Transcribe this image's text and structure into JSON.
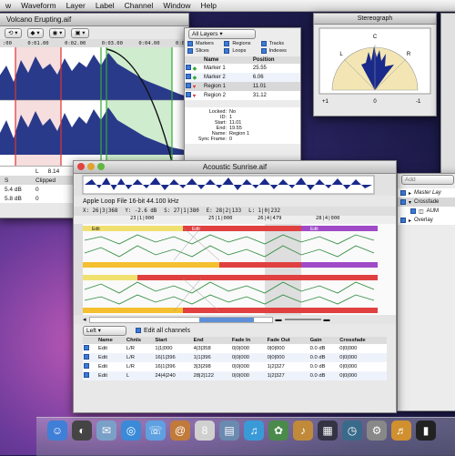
{
  "menubar": {
    "items": [
      "w",
      "Waveform",
      "Layer",
      "Label",
      "Channel",
      "Window",
      "Help"
    ]
  },
  "volcano_window": {
    "title": "Volcano Erupting.aif",
    "times": [
      ":00",
      "0:01.00",
      "0:02.00",
      "0:03.00",
      "0:04.00",
      "0:0"
    ],
    "readout_left": "L",
    "readout_value": "8.14",
    "rows": [
      {
        "a": "S",
        "b": "Clipped"
      },
      {
        "a": "5.4 dB",
        "b": "0"
      },
      {
        "a": "5.8 dB",
        "b": "0"
      }
    ]
  },
  "markers_panel": {
    "layers_select": "All Layers",
    "filters": [
      {
        "label": "Markers",
        "on": true
      },
      {
        "label": "Regions",
        "on": true
      },
      {
        "label": "Tracks",
        "on": true
      },
      {
        "label": "Slices",
        "on": true
      },
      {
        "label": "Loops",
        "on": true
      },
      {
        "label": "Indexes",
        "on": true
      }
    ],
    "columns": [
      "Name",
      "Position"
    ],
    "rows": [
      {
        "name": "Marker 1",
        "pos": "25.55",
        "kind": "marker"
      },
      {
        "name": "Marker 2",
        "pos": "6.06",
        "kind": "marker"
      },
      {
        "name": "Region 1",
        "pos": "11.01",
        "kind": "region"
      },
      {
        "name": "Region 2",
        "pos": "31.12",
        "kind": "region"
      }
    ],
    "details": [
      {
        "k": "Locked:",
        "v": "No"
      },
      {
        "k": "ID:",
        "v": "1"
      },
      {
        "k": "Start:",
        "v": "11.01"
      },
      {
        "k": "End:",
        "v": "19.55"
      },
      {
        "k": "Name:",
        "v": "Region 1"
      },
      {
        "k": "Sync Frame:",
        "v": "0"
      }
    ]
  },
  "stereograph": {
    "title": "Stereograph",
    "top_labels": [
      "L",
      "C",
      "R"
    ],
    "scale_left": "+1",
    "scale_mid": "0",
    "scale_right": "-1"
  },
  "right_panel": {
    "add_label": "Add",
    "items": [
      "Master Lay",
      "Crossfade",
      "AUM",
      "Overlay"
    ]
  },
  "acoustic_window": {
    "title": "Acoustic Sunrise.aif",
    "file_info": "Apple Loop File   16-bit  44.100 kHz",
    "coords": [
      "X: 26|3|368",
      "Y: -2.6 dB",
      "S: 27|1|380",
      "E: 28|2|133",
      "L: 1|0|232"
    ],
    "ruler": [
      "23|1|000",
      "25|1|000",
      "26|4|479",
      "28|4|000"
    ],
    "lane_labels": [
      "Edit",
      "Edit",
      "Edit"
    ],
    "channel_select": "Left",
    "edit_all_label": "Edit all channels",
    "columns": [
      "Name",
      "Chnls",
      "Start",
      "End",
      "Fade In",
      "Fade Out",
      "Gain",
      "Crossfade"
    ],
    "rows": [
      [
        "Edit",
        "L/R",
        "1|1|000",
        "4|3|358",
        "0|0|000",
        "0|0|000",
        "0.0 dB",
        "0|0|000"
      ],
      [
        "Edit",
        "L/R",
        "16|1|396",
        "1|1|396",
        "0|0|000",
        "0|0|000",
        "0.0 dB",
        "0|0|000"
      ],
      [
        "Edit",
        "L/R",
        "16|1|396",
        "3|3|298",
        "0|0|000",
        "1|2|327",
        "0.0 dB",
        "0|0|000"
      ],
      [
        "Edit",
        "L",
        "24|4|240",
        "28|2|122",
        "0|0|000",
        "1|2|327",
        "0.0 dB",
        "0|0|000"
      ]
    ]
  },
  "dock": {
    "items": [
      {
        "name": "finder-icon",
        "glyph": "☺",
        "color": "#3f7fd8"
      },
      {
        "name": "dashboard-icon",
        "glyph": "◐",
        "color": "#444"
      },
      {
        "name": "mail-icon",
        "glyph": "✉",
        "color": "#7aa0c8"
      },
      {
        "name": "safari-icon",
        "glyph": "◎",
        "color": "#3a8ad8"
      },
      {
        "name": "ichat-icon",
        "glyph": "☏",
        "color": "#5fa0e0"
      },
      {
        "name": "address-book-icon",
        "glyph": "@",
        "color": "#c07a3a"
      },
      {
        "name": "ical-icon",
        "glyph": "8",
        "color": "#d0d0d0"
      },
      {
        "name": "preview-icon",
        "glyph": "▤",
        "color": "#6a8ab0"
      },
      {
        "name": "itunes-icon",
        "glyph": "♫",
        "color": "#3a9ad8"
      },
      {
        "name": "iphoto-icon",
        "glyph": "✿",
        "color": "#4a8a4a"
      },
      {
        "name": "garageband-icon",
        "glyph": "♪",
        "color": "#c08a3a"
      },
      {
        "name": "spaces-icon",
        "glyph": "▦",
        "color": "#334"
      },
      {
        "name": "time-machine-icon",
        "glyph": "◷",
        "color": "#3a6a8a"
      },
      {
        "name": "system-preferences-icon",
        "glyph": "⚙",
        "color": "#888"
      },
      {
        "name": "soundtrack-icon",
        "glyph": "♬",
        "color": "#d09030"
      },
      {
        "name": "terminal-icon",
        "glyph": "▮",
        "color": "#222"
      }
    ]
  }
}
